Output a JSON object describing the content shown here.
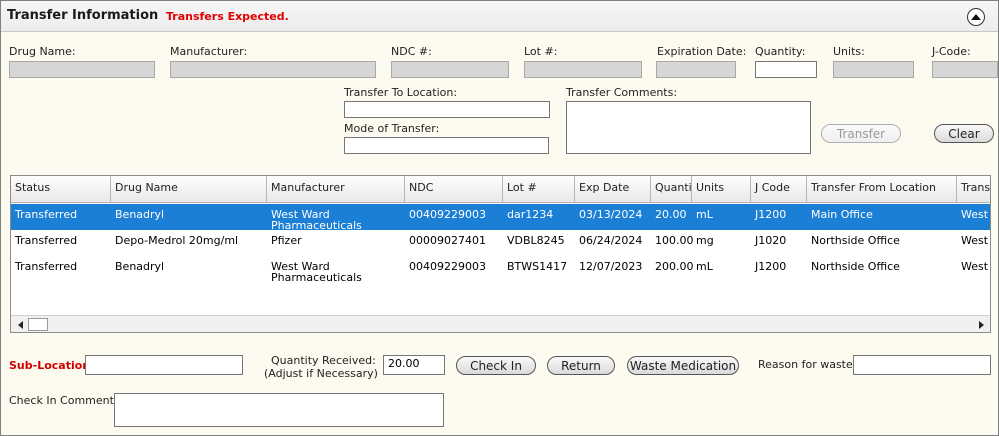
{
  "panel": {
    "title": "Transfer Information",
    "alert": "Transfers Expected."
  },
  "form": {
    "drug_name_label": "Drug Name:",
    "manufacturer_label": "Manufacturer:",
    "ndc_label": "NDC #:",
    "lot_label": "Lot #:",
    "expiration_label": "Expiration Date:",
    "quantity_label": "Quantity:",
    "units_label": "Units:",
    "jcode_label": "J-Code:",
    "transfer_to_label": "Transfer To Location:",
    "mode_label": "Mode of Transfer:",
    "comments_label": "Transfer Comments:",
    "transfer_button": "Transfer",
    "clear_button": "Clear"
  },
  "grid": {
    "columns": [
      "Status",
      "Drug Name",
      "Manufacturer",
      "NDC",
      "Lot #",
      "Exp Date",
      "Quanti",
      "Units",
      "J Code",
      "Transfer From Location",
      "Transf"
    ],
    "rows": [
      {
        "status": "Transferred",
        "drug": "Benadryl",
        "manufacturer_1": "West Ward",
        "manufacturer_2": "Pharmaceuticals",
        "ndc": "00409229003",
        "lot": "dar1234",
        "exp": "03/13/2024",
        "qty": "20.00",
        "units": "mL",
        "jcode": "J1200",
        "from": "Main Office",
        "to": "West S",
        "selected": true
      },
      {
        "status": "Transferred",
        "drug": "Depo-Medrol 20mg/ml",
        "manufacturer_1": "Pfizer",
        "manufacturer_2": "",
        "ndc": "00009027401",
        "lot": "VDBL8245",
        "exp": "06/24/2024",
        "qty": "100.00",
        "units": "mg",
        "jcode": "J1020",
        "from": "Northside Office",
        "to": "West S",
        "selected": false
      },
      {
        "status": "Transferred",
        "drug": "Benadryl",
        "manufacturer_1": "West Ward",
        "manufacturer_2": "Pharmaceuticals",
        "ndc": "00409229003",
        "lot": "BTWS1417",
        "exp": "12/07/2023",
        "qty": "200.00",
        "units": "mL",
        "jcode": "J1200",
        "from": "Northside Office",
        "to": "West S",
        "selected": false
      }
    ]
  },
  "checkin": {
    "sub_location_label": "Sub-Location:",
    "qty_received_label_1": "Quantity Received:",
    "qty_received_label_2": "(Adjust if Necessary)",
    "qty_received_value": "20.00",
    "check_in_button": "Check In",
    "return_button": "Return",
    "waste_button": "Waste Medication",
    "reason_label": "Reason for waste:",
    "comments_label": "Check In Comments:"
  },
  "colors": {
    "alert": "#e00000",
    "selected_row": "#1c7fd6",
    "panel_bg": "#fdfbef",
    "required_label": "#d00000"
  },
  "icons": {
    "collapse": "chevron-up-circle-icon",
    "scroll_left": "arrow-left-icon",
    "scroll_right": "arrow-right-icon"
  }
}
